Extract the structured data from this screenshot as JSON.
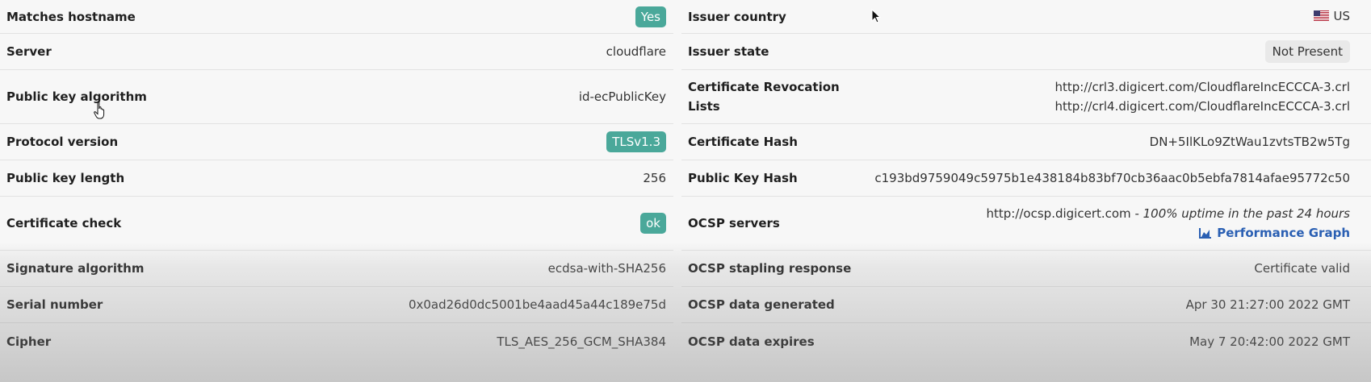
{
  "left_rows": [
    {
      "label": "Matches hostname",
      "value": "Yes",
      "kind": "badge"
    },
    {
      "label": "Server",
      "value": "cloudflare",
      "kind": "text"
    },
    {
      "label": "Public key algorithm",
      "value": "id-ecPublicKey",
      "kind": "text"
    },
    {
      "label": "Protocol version",
      "value": "TLSv1.3",
      "kind": "badge"
    },
    {
      "label": "Public key length",
      "value": "256",
      "kind": "text"
    },
    {
      "label": "Certificate check",
      "value": "ok",
      "kind": "badge"
    },
    {
      "label": "Signature algorithm",
      "value": "ecdsa-with-SHA256",
      "kind": "text"
    },
    {
      "label": "Serial number",
      "value": "0x0ad26d0dc5001be4aad45a44c189e75d",
      "kind": "text"
    },
    {
      "label": "Cipher",
      "value": "TLS_AES_256_GCM_SHA384",
      "kind": "text"
    }
  ],
  "right": {
    "issuer_country": {
      "label": "Issuer country",
      "value": "US",
      "flag_icon": "us-flag-icon"
    },
    "issuer_state": {
      "label": "Issuer state",
      "value": "Not Present"
    },
    "crl": {
      "label_line1": "Certificate Revocation",
      "label_line2": "Lists",
      "values": [
        "http://crl3.digicert.com/CloudflareIncECCCA-3.crl",
        "http://crl4.digicert.com/CloudflareIncECCCA-3.crl"
      ]
    },
    "cert_hash": {
      "label": "Certificate Hash",
      "value": "DN+5IlKLo9ZtWau1zvtsTB2w5Tg"
    },
    "pubkey_hash": {
      "label": "Public Key Hash",
      "value": "c193bd9759049c5975b1e438184b83bf70cb36aac0b5ebfa7814afae95772c50"
    },
    "ocsp_servers": {
      "label": "OCSP servers",
      "url": "http://ocsp.digicert.com",
      "separator": " - ",
      "uptime": "100% uptime in the past 24 hours",
      "link_label": "Performance Graph",
      "link_icon": "area-chart-icon"
    },
    "ocsp_stapling": {
      "label": "OCSP stapling response",
      "value": "Certificate valid"
    },
    "ocsp_generated": {
      "label": "OCSP data generated",
      "value": "Apr 30 21:27:00 2022 GMT"
    },
    "ocsp_expires": {
      "label": "OCSP data expires",
      "value": "May 7 20:42:00 2022 GMT"
    }
  },
  "colors": {
    "badge_green": "#4aa89a",
    "link_blue": "#2a5fb3",
    "badge_grey": "#e9e9e9"
  }
}
